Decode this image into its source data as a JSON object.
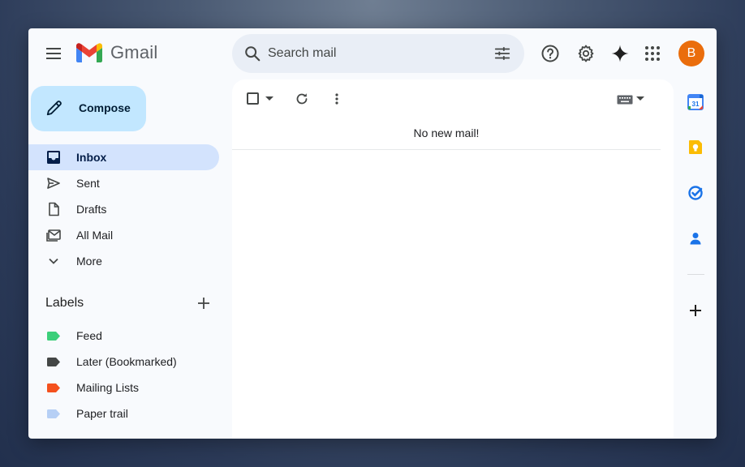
{
  "app": {
    "title": "Gmail",
    "avatar_letter": "B"
  },
  "search": {
    "placeholder": "Search mail"
  },
  "compose": {
    "label": "Compose"
  },
  "nav": {
    "items": [
      {
        "label": "Inbox",
        "icon": "inbox-icon",
        "active": true
      },
      {
        "label": "Sent",
        "icon": "send-icon"
      },
      {
        "label": "Drafts",
        "icon": "draft-icon"
      },
      {
        "label": "All Mail",
        "icon": "all-mail-icon"
      },
      {
        "label": "More",
        "icon": "chevron-down-icon"
      }
    ]
  },
  "labels": {
    "heading": "Labels",
    "items": [
      {
        "label": "Feed",
        "color": "#3ccf7a"
      },
      {
        "label": "Later (Bookmarked)",
        "color": "#444746"
      },
      {
        "label": "Mailing Lists",
        "color": "#f4511e"
      },
      {
        "label": "Paper trail",
        "color": "#b6cff5"
      }
    ]
  },
  "main": {
    "empty_message": "No new mail!"
  },
  "rail": {
    "calendar_day": "31",
    "icons": [
      "calendar-icon",
      "keep-icon",
      "tasks-icon",
      "contacts-icon",
      "add-icon"
    ]
  },
  "colors": {
    "accent": "#0b57d0",
    "compose_bg": "#c2e7ff",
    "active_nav_bg": "#d3e3fd",
    "avatar_bg": "#ea6d0c"
  }
}
